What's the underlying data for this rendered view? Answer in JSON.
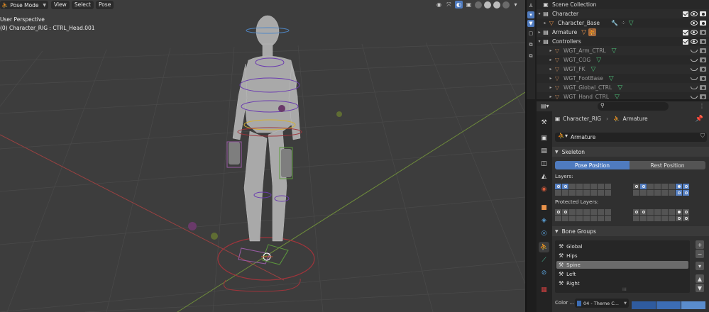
{
  "viewport": {
    "mode": "Pose Mode",
    "menus": [
      "View",
      "Select",
      "Pose"
    ],
    "perspective": "User Perspective",
    "active_object": "(0) Character_RIG : CTRL_Head.001"
  },
  "outliner": {
    "rows": [
      {
        "label": "Scene Collection",
        "icon": "collection-icon"
      },
      {
        "label": "Character",
        "icon": "collection-icon"
      },
      {
        "label": "Character_Base",
        "icon": "mesh-object-icon"
      },
      {
        "label": "Armature",
        "icon": "collection-icon"
      },
      {
        "label": "Controllers",
        "icon": "collection-icon"
      },
      {
        "label": "WGT_Arm_CTRL",
        "icon": "mesh-object-icon"
      },
      {
        "label": "WGT_COG",
        "icon": "mesh-object-icon"
      },
      {
        "label": "WGT_FK",
        "icon": "mesh-object-icon"
      },
      {
        "label": "WGT_FootBase",
        "icon": "mesh-object-icon"
      },
      {
        "label": "WGT_Global_CTRL",
        "icon": "mesh-object-icon"
      },
      {
        "label": "WGT_Hand_CTRL",
        "icon": "mesh-object-icon"
      }
    ]
  },
  "properties": {
    "breadcrumb_object": "Character_RIG",
    "breadcrumb_data": "Armature",
    "data_name": "Armature",
    "skeleton": {
      "title": "Skeleton",
      "pose_position": "Pose Position",
      "rest_position": "Rest Position",
      "layers_label": "Layers:",
      "protected_label": "Protected Layers:"
    },
    "bone_groups": {
      "title": "Bone Groups",
      "items": [
        "Global",
        "Hips",
        "Spine",
        "Left",
        "Right"
      ],
      "selected": "Spine",
      "color_set_label": "Color ...",
      "color_set_value": "04 - Theme C...",
      "colors": [
        "#2f5b9e",
        "#3c6db5",
        "#5a8ccc"
      ]
    }
  },
  "colors": {
    "accent": "#4f7bbf",
    "object_orange": "#e8924a",
    "mesh_green": "#4ec27a"
  }
}
